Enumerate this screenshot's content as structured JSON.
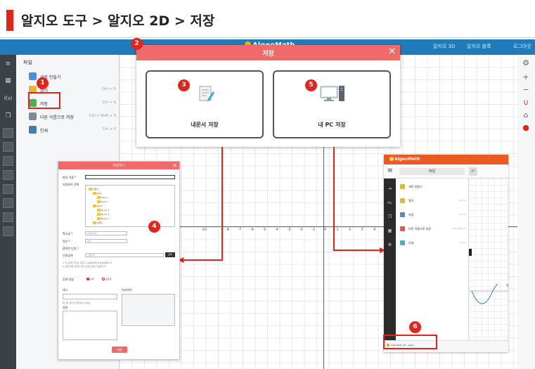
{
  "title": {
    "text": "알지오 도구 > 알지오 2D > 저장"
  },
  "app": {
    "logo": "AlgeoMath",
    "nav": [
      "알지오 3D",
      "알지오 블록",
      "로그아웃"
    ],
    "file_panel": {
      "header": "파일",
      "items": [
        {
          "label": "새로 만들기",
          "shortcut": ""
        },
        {
          "label": "열기",
          "shortcut": "Ctrl + O"
        },
        {
          "label": "저장",
          "shortcut": "Ctrl + S"
        },
        {
          "label": "다른 이름으로 저장",
          "shortcut": "Ctrl + Shift + S"
        },
        {
          "label": "인쇄",
          "shortcut": "Ctrl + P"
        }
      ]
    },
    "toolbar_labels": [
      "≡",
      "f(x)"
    ],
    "axis_labels": [
      "-10",
      "-8",
      "-7",
      "-6",
      "-5",
      "-4",
      "-3",
      "-2",
      "-1",
      "0",
      "1",
      "2",
      "3",
      "4",
      "5",
      "6",
      "7",
      "8",
      "9",
      "10"
    ]
  },
  "save_dialog": {
    "title": "저장",
    "close": "✕",
    "option_mydocs": "내문서 저장",
    "option_mypc": "내 PC 저장"
  },
  "badges": [
    "1",
    "2",
    "3",
    "4",
    "5",
    "6"
  ],
  "save_as_dialog": {
    "title": "저장하기",
    "close": "✕",
    "label_filename": "파일 이름 *",
    "label_folder": "저장위치 선택",
    "tree": [
      "내문서",
      "Test",
      "Test_1",
      "Test_2",
      "Test1",
      "Node_1",
      "Node_2",
      "Node_3",
      "내폴더"
    ],
    "label_grade": "학교급 *",
    "grade_value": "선택하세요",
    "label_subject": "학년 *",
    "subject_value": "선택",
    "label_related": "관련된 단원 ]",
    "label_unit": "단원검색",
    "unit_placeholder": "단원검색",
    "search_btn": "검색",
    "notice_1": "※ 학교급과 학년은 공개 시 교육과정에 맞게 분류됩니다.",
    "notice_2": "※ 공개 여부 설정은 저장 후에도 변경 가능합니다.",
    "label_public": "공개 설정",
    "radio_public": "공개",
    "radio_private": "비공개",
    "label_tags": "태그",
    "label_preview": "미리보기",
    "tags_hint": "태그를 입력 후 엔터를 누르세요.",
    "label_desc": "설명",
    "save_btn": "저장"
  },
  "mobile": {
    "logo": "AlgeoMath",
    "file_pill": "파일",
    "items": [
      {
        "label": "새로 만들기",
        "shortcut": ""
      },
      {
        "label": "열기",
        "shortcut": "Ctrl+O"
      },
      {
        "label": "저장",
        "shortcut": "Ctrl+S"
      },
      {
        "label": "다른 이름으로 저장",
        "shortcut": "Ctrl+Shift+S"
      },
      {
        "label": "인쇄",
        "shortcut": "Ctrl+P"
      }
    ],
    "download": "AlgeoMath_2D...algeo"
  },
  "colors": {
    "accent_red": "#e1251b",
    "dialog_header": "#f06a6a",
    "app_blue": "#1f7bb9",
    "mobile_orange": "#ec5a1f"
  }
}
